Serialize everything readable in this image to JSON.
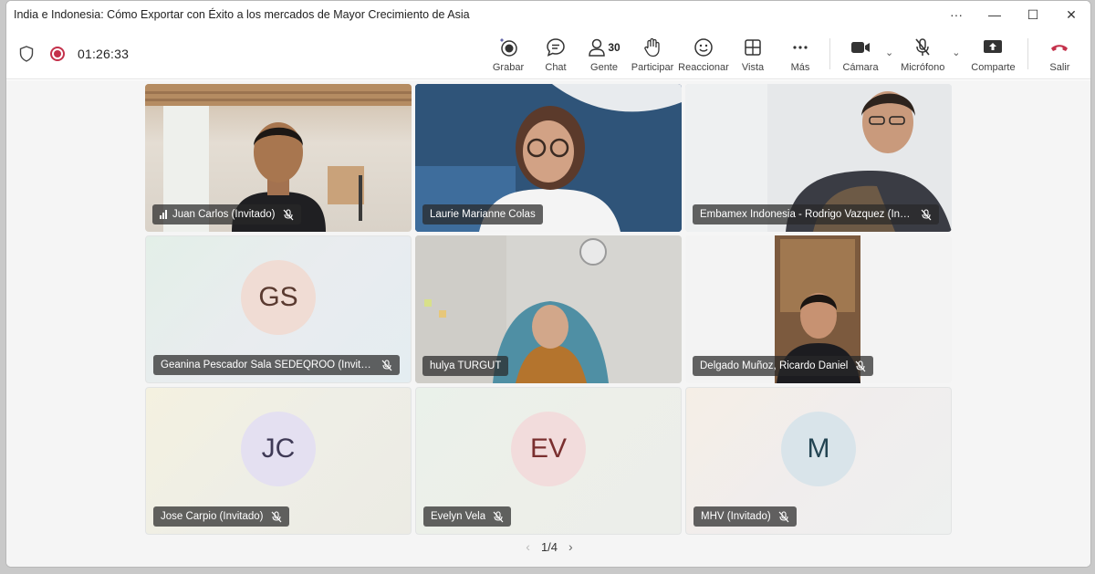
{
  "window": {
    "title": "India e Indonesia: Cómo Exportar con Éxito a los mercados de Mayor Crecimiento de Asia",
    "controls": [
      "···",
      "—",
      "☐",
      "✕"
    ]
  },
  "status": {
    "timer": "01:26:33"
  },
  "toolbar": {
    "record": "Grabar",
    "chat": "Chat",
    "people": "Gente",
    "people_count": "30",
    "raise": "Participar",
    "react": "Reaccionar",
    "view": "Vista",
    "more": "Más",
    "camera": "Cámara",
    "mic": "Micrófono",
    "share": "Comparte",
    "leave": "Salir"
  },
  "participants": [
    {
      "name": "Juan Carlos (Invitado)",
      "type": "video"
    },
    {
      "name": "Laurie Marianne Colas",
      "type": "video",
      "active": true
    },
    {
      "name": "Embamex Indonesia - Rodrigo Vazquez (Invita...",
      "type": "video"
    },
    {
      "name": "Geanina Pescador Sala SEDEQROO (Invitado)",
      "type": "avatar",
      "initials": "GS"
    },
    {
      "name": "hulya TURGUT",
      "type": "video"
    },
    {
      "name": "Delgado Muñoz, Ricardo Daniel",
      "type": "video"
    },
    {
      "name": "Jose Carpio (Invitado)",
      "type": "avatar",
      "initials": "JC"
    },
    {
      "name": "Evelyn Vela",
      "type": "avatar",
      "initials": "EV"
    },
    {
      "name": "MHV (Invitado)",
      "type": "avatar",
      "initials": "M"
    }
  ],
  "pager": {
    "label": "1/4"
  },
  "colors": {
    "accent": "#6264a7",
    "leave": "#c4314b",
    "record": "#c4314b"
  }
}
